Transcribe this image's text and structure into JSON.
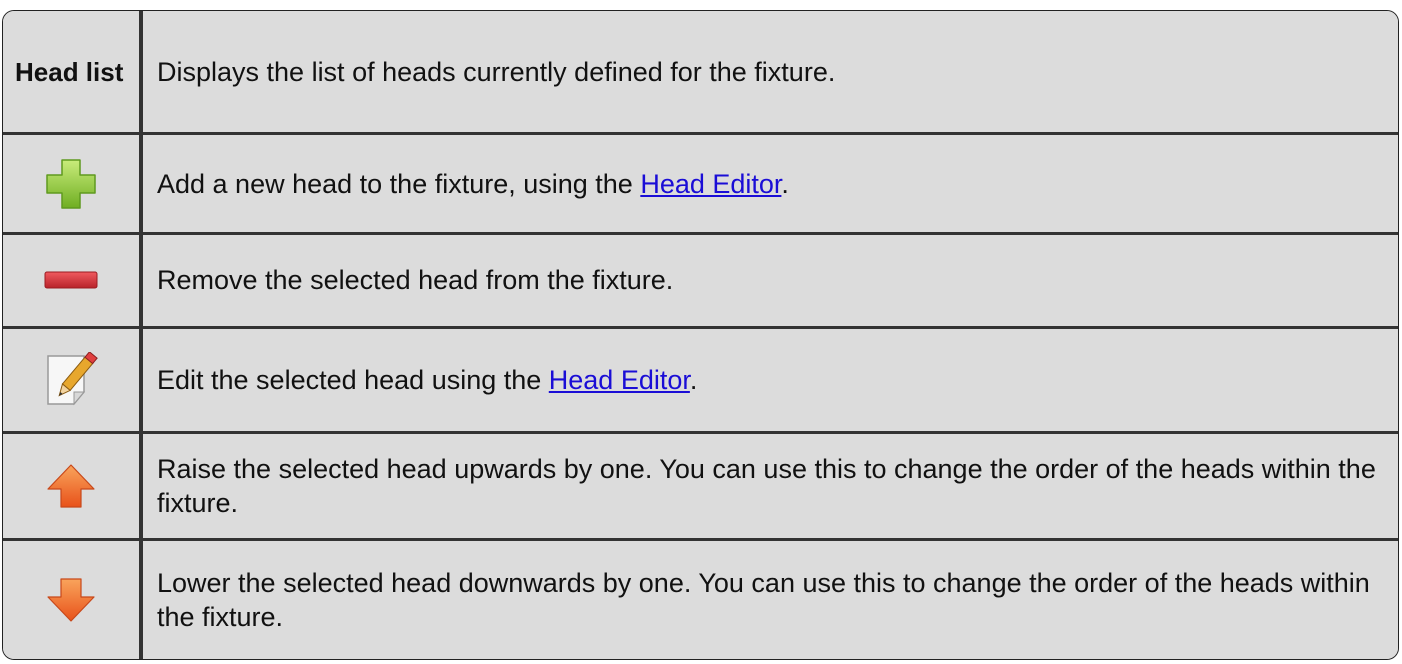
{
  "rows": [
    {
      "label": "Head list",
      "description": "Displays the list of heads currently defined for the fixture."
    },
    {
      "icon": "add-plus-icon",
      "description_before": "Add a new head to the fixture, using the ",
      "link": "Head Editor",
      "description_after": "."
    },
    {
      "icon": "remove-minus-icon",
      "description": "Remove the selected head from the fixture."
    },
    {
      "icon": "edit-pencil-icon",
      "description_before": "Edit the selected head using the ",
      "link": "Head Editor",
      "description_after": "."
    },
    {
      "icon": "raise-up-arrow-icon",
      "description": "Raise the selected head upwards by one. You can use this to change the order of the heads within the fixture."
    },
    {
      "icon": "lower-down-arrow-icon",
      "description": "Lower the selected head downwards by one. You can use this to change the order of the heads within the fixture."
    }
  ],
  "colors": {
    "cell_background": "#dcdcdc",
    "border": "#333333",
    "link": "#1a0dd6",
    "add_green": "#8cc63f",
    "remove_red": "#d9363e",
    "arrow_orange": "#f26b21"
  }
}
